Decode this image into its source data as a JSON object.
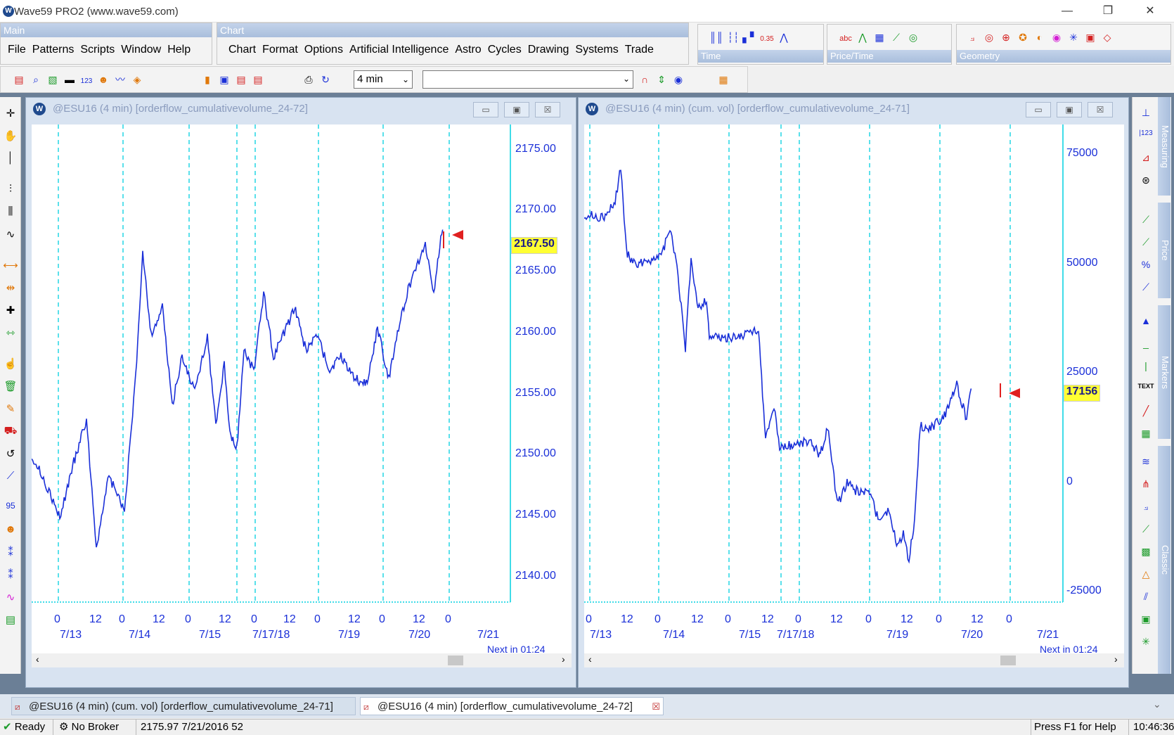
{
  "window": {
    "title": "Wave59 PRO2 (www.wave59.com)",
    "logo": "W",
    "min": "—",
    "restore": "❐",
    "close": "✕"
  },
  "main_panel": {
    "label": "Main",
    "menu": [
      "File",
      "Patterns",
      "Scripts",
      "Window",
      "Help"
    ]
  },
  "chart_panel": {
    "label": "Chart",
    "menu": [
      "Chart",
      "Format",
      "Options",
      "Artificial Intelligence",
      "Astro",
      "Cycles",
      "Drawing",
      "Systems",
      "Trade"
    ]
  },
  "toolbars": {
    "time": {
      "label": "Time"
    },
    "price_time": {
      "label": "Price/Time"
    },
    "geometry": {
      "label": "Geometry"
    }
  },
  "interval_select": {
    "value": "4 min"
  },
  "right_panels": [
    "Measuring",
    "Price",
    "Markers",
    "Classic"
  ],
  "left_chart": {
    "title": "@ESU16 (4 min) [orderflow_cumulativevolume_24-72]",
    "price_labels": [
      "2175.00",
      "2170.00",
      "2165.00",
      "2160.00",
      "2155.00",
      "2150.00",
      "2145.00",
      "2140.00"
    ],
    "last_price": "2167.50",
    "hour_labels": [
      "0",
      "12",
      "0",
      "12",
      "0",
      "12",
      "0",
      "12",
      "0",
      "12",
      "0",
      "12",
      "0"
    ],
    "date_labels": [
      "7/13",
      "7/14",
      "7/15",
      "7/17/18",
      "7/19",
      "7/20",
      "7/21"
    ],
    "next_bar": "Next in 01:24"
  },
  "right_chart": {
    "title": "@ESU16 (4 min) (cum. vol) [orderflow_cumulativevolume_24-71]",
    "value_labels": [
      "75000",
      "50000",
      "25000",
      "0",
      "-25000"
    ],
    "last_value": "17156",
    "hour_labels": [
      "0",
      "12",
      "0",
      "12",
      "0",
      "12",
      "0",
      "12",
      "0",
      "12",
      "0",
      "12",
      "0"
    ],
    "date_labels": [
      "7/13",
      "7/14",
      "7/15",
      "7/17/18",
      "7/19",
      "7/20",
      "7/21"
    ],
    "next_bar": "Next in 01:24"
  },
  "tabs": [
    {
      "label": "@ESU16 (4 min) (cum. vol) [orderflow_cumulativevolume_24-71]"
    },
    {
      "label": "@ESU16 (4 min) [orderflow_cumulativevolume_24-72]"
    }
  ],
  "status": {
    "ready": "Ready",
    "broker": "No Broker",
    "quote": "2175.97  7/21/2016  52",
    "help": "Press F1 for Help",
    "time": "10:46:36"
  },
  "colors": {
    "series": "#1a2fd8",
    "grid": "#00d0e0",
    "highlight": "#ffff33",
    "alert": "#e02020"
  }
}
